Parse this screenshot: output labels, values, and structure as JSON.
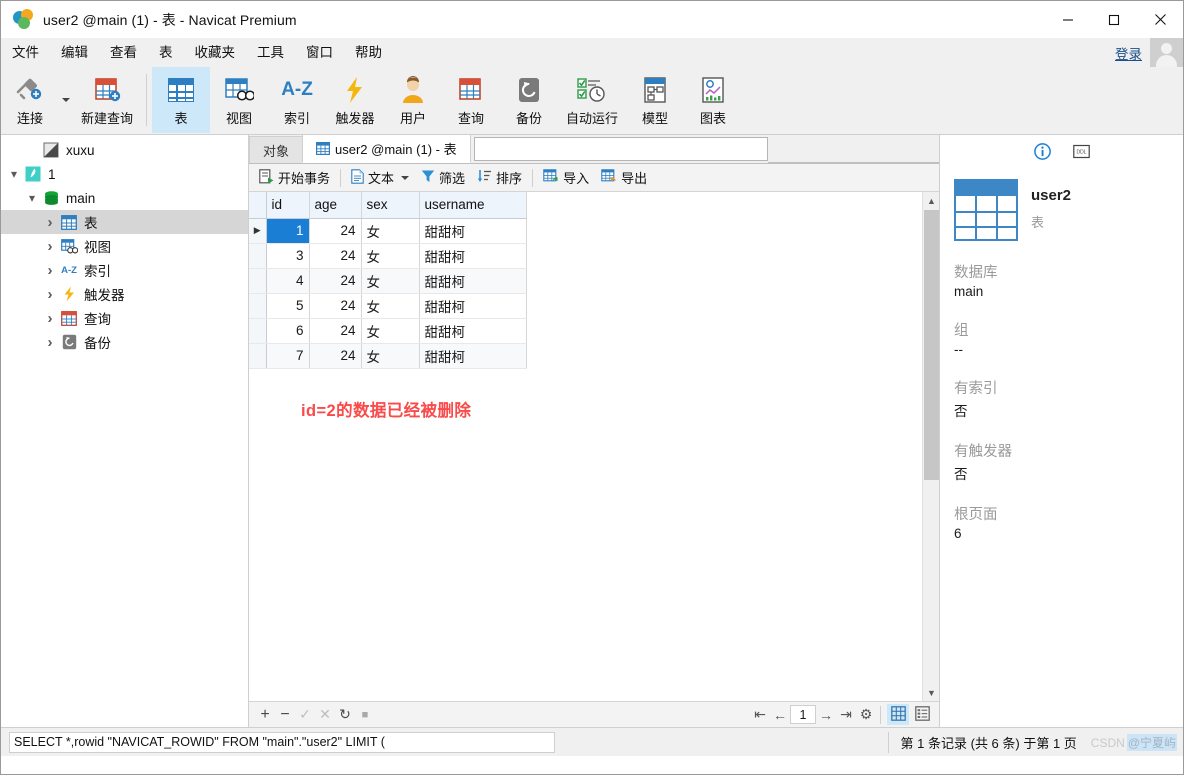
{
  "window": {
    "title": "user2 @main (1) - 表 - Navicat Premium",
    "minimize": "—",
    "maximize": "□",
    "close": "✕"
  },
  "menubar": {
    "items": [
      "文件",
      "编辑",
      "查看",
      "表",
      "收藏夹",
      "工具",
      "窗口",
      "帮助"
    ],
    "login_label": "登录"
  },
  "toolbar": {
    "buttons": [
      {
        "label": "连接",
        "icon": "connection-icon"
      },
      {
        "label": "新建查询",
        "icon": "new-query-icon"
      },
      {
        "label": "表",
        "icon": "table-icon",
        "active": true
      },
      {
        "label": "视图",
        "icon": "view-icon"
      },
      {
        "label": "索引",
        "icon": "index-az-icon"
      },
      {
        "label": "触发器",
        "icon": "trigger-bolt-icon"
      },
      {
        "label": "用户",
        "icon": "user-icon"
      },
      {
        "label": "查询",
        "icon": "query-icon"
      },
      {
        "label": "备份",
        "icon": "backup-icon"
      },
      {
        "label": "自动运行",
        "icon": "automation-icon"
      },
      {
        "label": "模型",
        "icon": "model-icon"
      },
      {
        "label": "图表",
        "icon": "chart-icon"
      }
    ]
  },
  "sidebar": {
    "items": [
      {
        "label": "xuxu",
        "indent": 0,
        "chev": "blank",
        "icon": "navicat-connection-icon",
        "selected": false
      },
      {
        "label": "1",
        "indent": 0,
        "chev": "down",
        "icon": "sqlite-icon",
        "selected": false
      },
      {
        "label": "main",
        "indent": 1,
        "chev": "down",
        "icon": "database-icon",
        "selected": false
      },
      {
        "label": "表",
        "indent": 2,
        "chev": "right",
        "icon": "table-icon",
        "selected": true
      },
      {
        "label": "视图",
        "indent": 2,
        "chev": "right",
        "icon": "view-icon",
        "selected": false
      },
      {
        "label": "索引",
        "indent": 2,
        "chev": "right",
        "icon": "index-az-icon",
        "selected": false
      },
      {
        "label": "触发器",
        "indent": 2,
        "chev": "right",
        "icon": "trigger-bolt-icon",
        "selected": false
      },
      {
        "label": "查询",
        "indent": 2,
        "chev": "right",
        "icon": "query-icon",
        "selected": false
      },
      {
        "label": "备份",
        "indent": 2,
        "chev": "right",
        "icon": "backup-icon",
        "selected": false
      }
    ]
  },
  "tabs": {
    "objects_tab": "对象",
    "active_tab": "user2 @main (1) - 表",
    "search_value": ""
  },
  "gridtools": {
    "begin_transaction": "开始事务",
    "text": "文本",
    "filter": "筛选",
    "sort": "排序",
    "import": "导入",
    "export": "导出"
  },
  "grid": {
    "columns": [
      "id",
      "age",
      "sex",
      "username"
    ],
    "rows": [
      {
        "id": "1",
        "age": "24",
        "sex": "女",
        "username": "甜甜柯",
        "selected": true
      },
      {
        "id": "3",
        "age": "24",
        "sex": "女",
        "username": "甜甜柯",
        "selected": false
      },
      {
        "id": "4",
        "age": "24",
        "sex": "女",
        "username": "甜甜柯",
        "selected": false
      },
      {
        "id": "5",
        "age": "24",
        "sex": "女",
        "username": "甜甜柯",
        "selected": false
      },
      {
        "id": "6",
        "age": "24",
        "sex": "女",
        "username": "甜甜柯",
        "selected": false
      },
      {
        "id": "7",
        "age": "24",
        "sex": "女",
        "username": "甜甜柯",
        "selected": false
      }
    ],
    "annotation": "id=2的数据已经被删除",
    "annotation_color": "#fa4a4a"
  },
  "gridnav": {
    "add": "+",
    "remove": "−",
    "confirm": "✓",
    "cancel": "✕",
    "refresh": "↻",
    "stop": "■",
    "first": "⇤",
    "prev": "←",
    "page": "1",
    "next": "→",
    "last": "⇥",
    "settings": "⚙",
    "grid_view": "grid-view-icon",
    "form_view": "form-view-icon"
  },
  "statusbar": {
    "sql": "SELECT *,rowid \"NAVICAT_ROWID\" FROM \"main\".\"user2\" LIMIT (",
    "records": "第 1 条记录 (共 6 条) 于第 1 页",
    "watermark_prefix": "CSDN ",
    "watermark_handle": "@宁夏屿"
  },
  "infopanel": {
    "info_icon": "info-icon",
    "ddl_icon": "ddl-icon",
    "name": "user2",
    "subtitle": "表",
    "fields": [
      {
        "label": "数据库",
        "value": "main"
      },
      {
        "label": "组",
        "value": "--"
      },
      {
        "label": "有索引",
        "value": "否"
      },
      {
        "label": "有触发器",
        "value": "否"
      },
      {
        "label": "根页面",
        "value": "6"
      }
    ]
  },
  "colors": {
    "accent": "#2e7fc1",
    "selection": "#1a7fd4",
    "active_tool": "#cde8f9",
    "annotation": "#fa4a4a"
  }
}
